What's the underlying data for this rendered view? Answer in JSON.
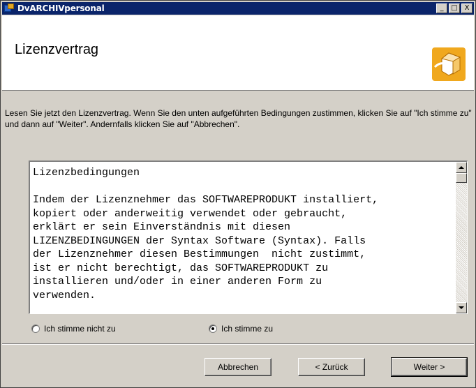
{
  "window": {
    "title": "DvARCHIVpersonal",
    "minimize": "_",
    "maximize": "□",
    "close": "X"
  },
  "banner": {
    "title": "Lizenzvertrag",
    "logo_icon": "installer-box-icon",
    "logo_color": "#f0a81e"
  },
  "intro_text": "Lesen Sie jetzt den Lizenzvertrag. Wenn Sie den unten aufgeführten Bedingungen zustimmen, klicken Sie auf  \"Ich stimme zu\" und dann auf \"Weiter\". Andernfalls klicken Sie auf \"Abbrechen\".",
  "license": {
    "text": "Lizenzbedingungen\n\nIndem der Lizenznehmer das SOFTWAREPRODUKT installiert,\nkopiert oder anderweitig verwendet oder gebraucht,\nerklärt er sein Einverständnis mit diesen\nLIZENZBEDINGUNGEN der Syntax Software (Syntax). Falls\nder Lizenznehmer diesen Bestimmungen  nicht zustimmt,\nist er nicht berechtigt, das SOFTWAREPRODUKT zu\ninstallieren und/oder in einer anderen Form zu\nverwenden."
  },
  "radios": {
    "disagree_label": "Ich stimme nicht zu",
    "agree_label": "Ich stimme zu",
    "selected": "agree"
  },
  "buttons": {
    "cancel": "Abbrechen",
    "back": "< Zurück",
    "next": "Weiter >"
  }
}
